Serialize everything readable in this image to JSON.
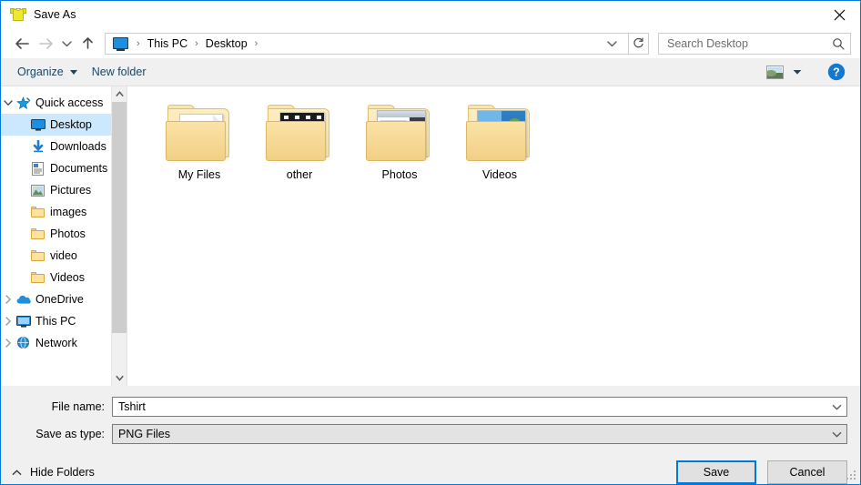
{
  "window": {
    "title": "Save As",
    "icon": "tshirt-icon",
    "close_label": "✕"
  },
  "address_bar": {
    "back_icon": "back-arrow-icon",
    "forward_icon": "forward-arrow-icon",
    "recent_icon": "chevron-down-icon",
    "up_icon": "up-arrow-icon",
    "breadcrumb": {
      "root_icon": "this-pc-icon",
      "items": [
        "This PC",
        "Desktop"
      ],
      "separator": "›"
    },
    "refresh_icon": "refresh-icon",
    "search": {
      "placeholder": "Search Desktop",
      "icon": "search-icon"
    }
  },
  "toolbar": {
    "organize_label": "Organize",
    "new_folder_label": "New folder",
    "view_icon": "view-layout-icon",
    "view_caret_icon": "chevron-down-icon",
    "help_icon": "help-icon",
    "help_label": "?"
  },
  "nav_pane": {
    "items": [
      {
        "label": "Quick access",
        "icon": "quick-access-star-icon",
        "indent": 0,
        "expander": "expanded",
        "pinned": false,
        "selected": false
      },
      {
        "label": "Desktop",
        "icon": "desktop-monitor-icon",
        "indent": 2,
        "expander": "none",
        "pinned": true,
        "selected": true
      },
      {
        "label": "Downloads",
        "icon": "downloads-arrow-icon",
        "indent": 2,
        "expander": "none",
        "pinned": true,
        "selected": false
      },
      {
        "label": "Documents",
        "icon": "documents-icon",
        "indent": 2,
        "expander": "none",
        "pinned": true,
        "selected": false
      },
      {
        "label": "Pictures",
        "icon": "pictures-icon",
        "indent": 2,
        "expander": "none",
        "pinned": true,
        "selected": false
      },
      {
        "label": "images",
        "icon": "folder-icon",
        "indent": 2,
        "expander": "none",
        "pinned": false,
        "selected": false
      },
      {
        "label": "Photos",
        "icon": "folder-icon",
        "indent": 2,
        "expander": "none",
        "pinned": false,
        "selected": false
      },
      {
        "label": "video",
        "icon": "folder-icon",
        "indent": 2,
        "expander": "none",
        "pinned": false,
        "selected": false
      },
      {
        "label": "Videos",
        "icon": "folder-icon",
        "indent": 2,
        "expander": "none",
        "pinned": false,
        "selected": false
      },
      {
        "label": "OneDrive",
        "icon": "onedrive-cloud-icon",
        "indent": 0,
        "expander": "collapsed",
        "pinned": false,
        "selected": false
      },
      {
        "label": "This PC",
        "icon": "this-pc-icon",
        "indent": 0,
        "expander": "collapsed",
        "pinned": false,
        "selected": false
      },
      {
        "label": "Network",
        "icon": "network-globe-icon",
        "indent": 0,
        "expander": "collapsed",
        "pinned": false,
        "selected": false
      }
    ],
    "scrollbar": {
      "up_icon": "scroll-up-icon",
      "down_icon": "scroll-down-icon"
    }
  },
  "file_list": {
    "items": [
      {
        "label": "My Files",
        "thumb": "document-folder-thumb"
      },
      {
        "label": "other",
        "thumb": "film-folder-thumb"
      },
      {
        "label": "Photos",
        "thumb": "screenshot-folder-thumb"
      },
      {
        "label": "Videos",
        "thumb": "photo-collage-folder-thumb"
      }
    ]
  },
  "form": {
    "file_name_label": "File name:",
    "file_name_value": "Tshirt",
    "save_as_type_label": "Save as type:",
    "save_as_type_value": "PNG Files",
    "dropdown_icon": "chevron-down-icon"
  },
  "footer": {
    "hide_folders_label": "Hide Folders",
    "hide_folders_icon": "chevron-up-icon",
    "save_label": "Save",
    "cancel_label": "Cancel",
    "resize_grip_icon": "resize-grip-icon"
  },
  "colors": {
    "accent": "#0078d7",
    "selection": "#cce8ff",
    "chrome": "#f0f0f0",
    "toolbar_text": "#1a4663",
    "folder": "#fde2a0"
  }
}
